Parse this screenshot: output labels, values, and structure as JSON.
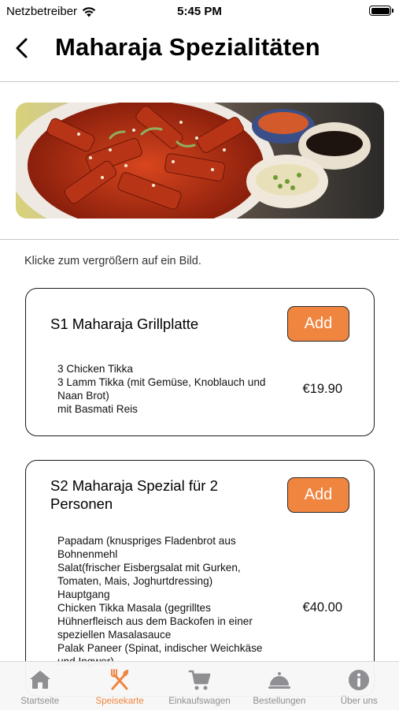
{
  "status_bar": {
    "carrier": "Netzbetreiber",
    "time": "5:45 PM"
  },
  "header": {
    "title": "Maharaja Spezialitäten"
  },
  "hint": "Klicke zum vergrößern auf ein Bild.",
  "menu_items": [
    {
      "title": "S1 Maharaja Grillplatte",
      "add_label": "Add",
      "description": [
        "3 Chicken Tikka",
        "3 Lamm Tikka (mit Gemüse, Knoblauch und",
        "Naan Brot)",
        "mit Basmati Reis"
      ],
      "price": "€19.90"
    },
    {
      "title_lines": [
        "S2 Maharaja Spezial für 2",
        "Personen"
      ],
      "add_label": "Add",
      "description": [
        "Papadam (knuspriges Fladenbrot aus",
        "Bohnenmehl",
        "Salat(frischer Eisbergsalat mit Gurken,",
        "Tomaten, Mais, Joghurtdressing)",
        "Hauptgang",
        "Chicken Tikka Masala (gegrilltes",
        "Hühnerfleisch aus dem Backofen in einer",
        "speziellen Masalasauce",
        "Palak Paneer (Spinat, indischer Weichkäse",
        "und Ingwer)"
      ],
      "price": "€40.00"
    }
  ],
  "tab_bar": {
    "tabs": [
      {
        "label": "Startseite",
        "icon": "home-icon"
      },
      {
        "label": "Speisekarte",
        "icon": "fork-knife-icon",
        "active": true
      },
      {
        "label": "Einkaufswagen",
        "icon": "cart-icon"
      },
      {
        "label": "Bestellungen",
        "icon": "cloche-icon"
      },
      {
        "label": "Über uns",
        "icon": "info-icon"
      }
    ]
  },
  "colors": {
    "accent": "#f0853f",
    "tab_inactive": "#8e8e93",
    "divider": "#c6c6c8"
  }
}
